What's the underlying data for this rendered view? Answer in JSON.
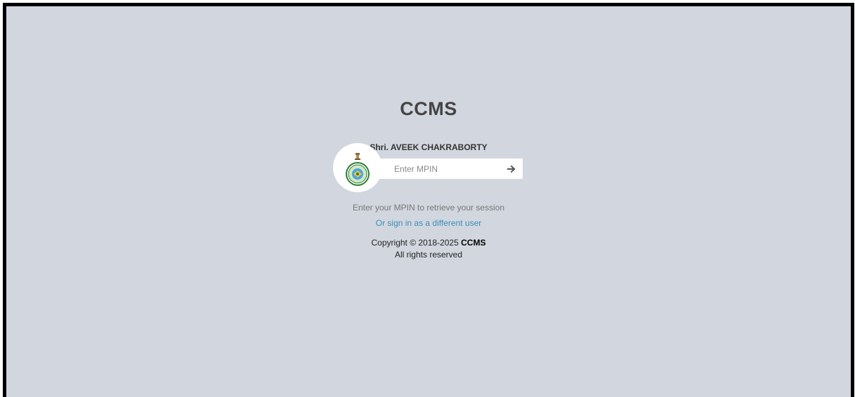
{
  "app": {
    "title": "CCMS"
  },
  "user": {
    "name": "Shri. AVEEK CHAKRABORTY"
  },
  "mpin": {
    "placeholder": "Enter MPIN",
    "value": ""
  },
  "submit": {
    "icon": "arrow-right-icon"
  },
  "help_text": "Enter your MPIN to retrieve your session",
  "alt_signin_label": "Or sign in as a different user",
  "footer": {
    "copyright_prefix": "Copyright © 2018-2025",
    "brand": "CCMS",
    "rights": "All rights reserved"
  },
  "colors": {
    "background": "#d2d6de",
    "link": "#3c8dbc",
    "title": "#444444"
  }
}
